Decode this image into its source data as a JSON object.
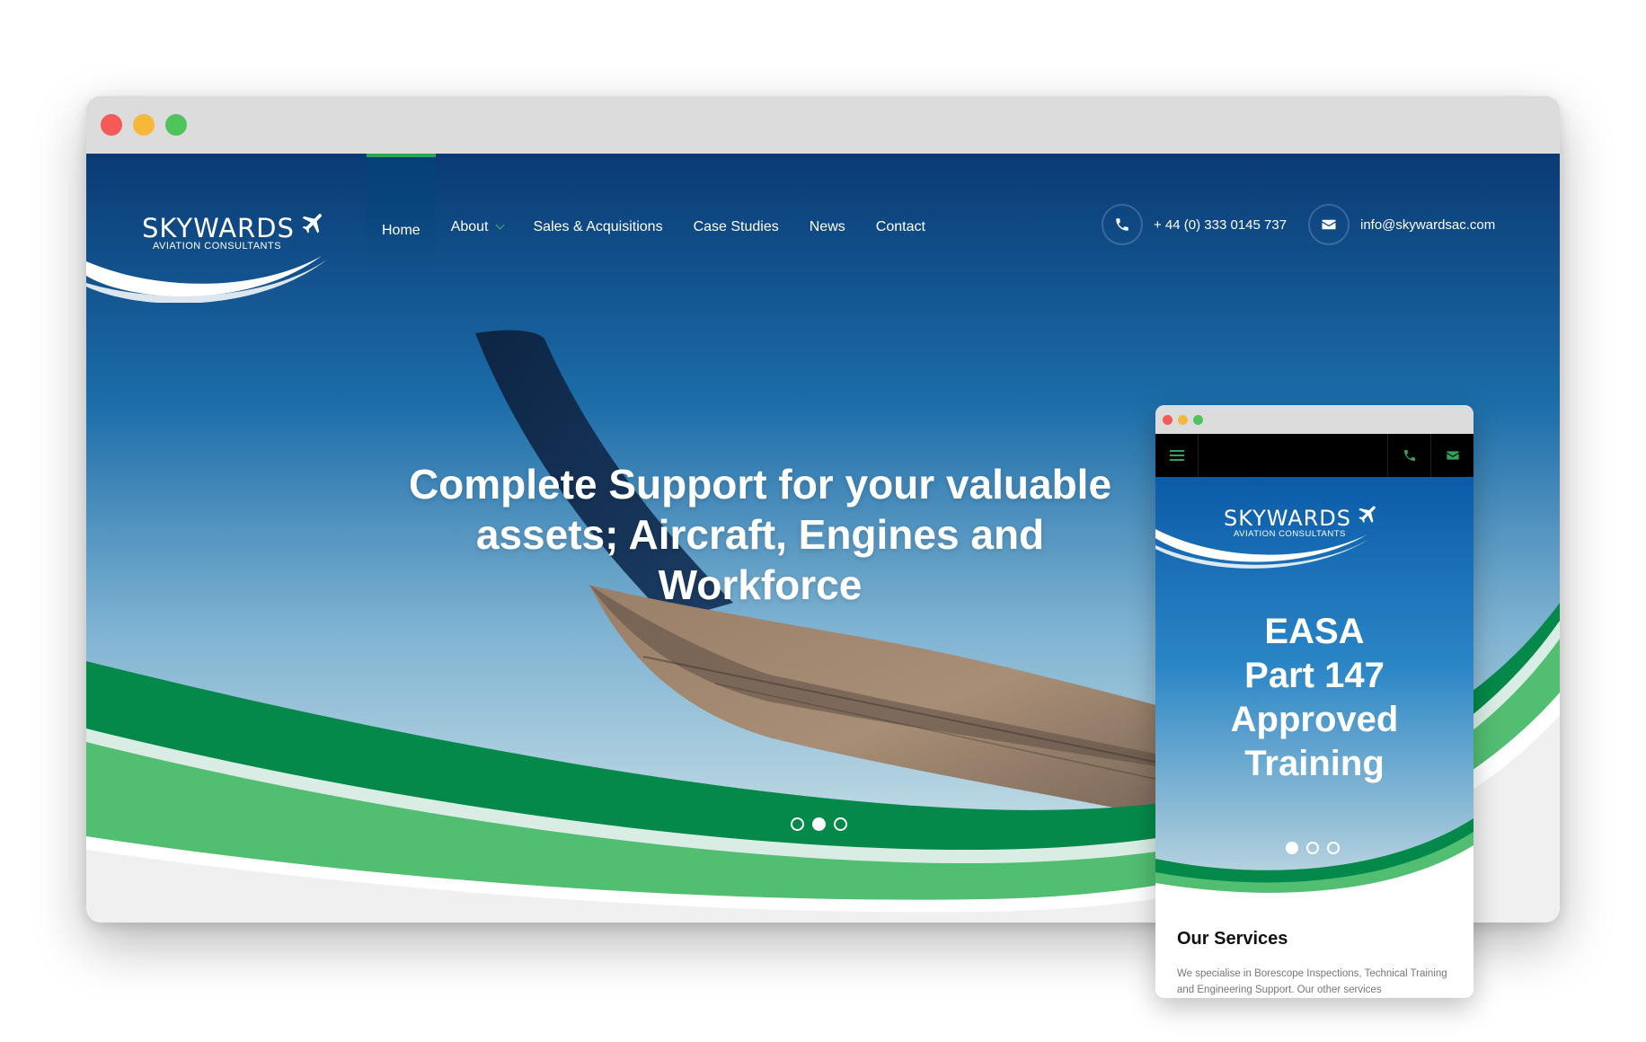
{
  "desktop": {
    "window_controls": [
      "close",
      "minimize",
      "maximize"
    ],
    "logo": {
      "name": "SKYWARDS",
      "tagline": "AVIATION CONSULTANTS",
      "icon": "airplane-icon"
    },
    "nav": [
      {
        "label": "Home",
        "active": true
      },
      {
        "label": "About",
        "has_dropdown": true
      },
      {
        "label": "Sales & Acquisitions"
      },
      {
        "label": "Case Studies"
      },
      {
        "label": "News"
      },
      {
        "label": "Contact"
      }
    ],
    "phone": {
      "icon": "phone-icon",
      "text": "+ 44 (0) 333 0145 737"
    },
    "email": {
      "icon": "envelope-icon",
      "text": "info@skywardsac.com"
    },
    "hero": {
      "headline": "Complete Support for your valuable assets; Aircraft, Engines and Workforce",
      "slides_total": 3,
      "active_slide": 2
    }
  },
  "mobile": {
    "window_controls": [
      "close",
      "minimize",
      "maximize"
    ],
    "toolbar": {
      "menu_icon": "hamburger-icon",
      "phone_icon": "phone-icon",
      "email_icon": "envelope-icon"
    },
    "logo": {
      "name": "SKYWARDS",
      "tagline": "AVIATION CONSULTANTS"
    },
    "hero": {
      "headline_lines": [
        "EASA",
        "Part 147",
        "Approved",
        "Training"
      ],
      "slides_total": 3,
      "active_slide": 1
    },
    "services": {
      "title": "Our Services",
      "text": "We specialise in Borescope Inspections, Technical Training and Engineering Support. Our other services"
    }
  },
  "colors": {
    "sky_top": "#0a3a74",
    "sky_bottom": "#b2d3e2",
    "green_dark": "#05894a",
    "green_light": "#52be72",
    "accent": "#2fa357"
  }
}
